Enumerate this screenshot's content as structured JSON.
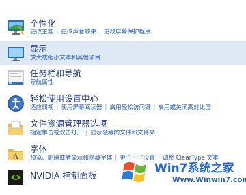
{
  "items": [
    {
      "title": "个性化",
      "links": [
        "更改主题",
        "更改声音效果",
        "更改屏幕保护程序"
      ],
      "icon": "personalization-icon"
    },
    {
      "title": "显示",
      "links": [
        "放大或缩小文本和其他项目"
      ],
      "icon": "display-icon",
      "selected": true
    },
    {
      "title": "任务栏和导航",
      "links": [
        "导航属性"
      ],
      "icon": "taskbar-icon"
    },
    {
      "title": "轻松使用设置中心",
      "links": [
        "适应弱视",
        "使用屏幕阅读器",
        "启用轻松访问键",
        "启用或关闭高对比度"
      ],
      "icon": "ease-of-access-icon"
    },
    {
      "title": "文件资源管理器选项",
      "links": [
        "指定单击或双击打开",
        "显示隐藏的文件和文件夹"
      ],
      "icon": "folder-options-icon"
    },
    {
      "title": "字体",
      "links": [
        "预览、删除或者显示和隐藏字体",
        "更改字体设置",
        "调整 ClearType 文本"
      ],
      "icon": "fonts-icon"
    },
    {
      "title": "NVIDIA 控制面板",
      "links": [],
      "icon": "nvidia-icon"
    }
  ],
  "watermark": {
    "brand": "Win7系统之家",
    "url": "Www.Winwin7.com"
  },
  "colors": {
    "title": "#1e3a78",
    "link": "#1f57b0",
    "selected_bg": "#dfe9f5"
  }
}
